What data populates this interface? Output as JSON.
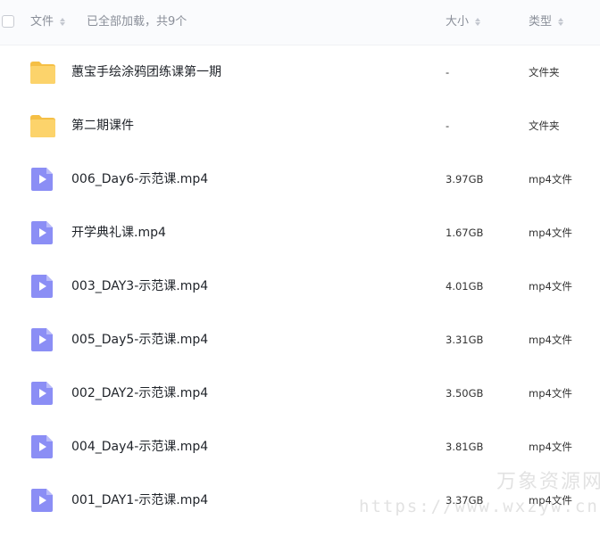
{
  "header": {
    "file_label": "文件",
    "status_text": "已全部加载，共9个",
    "size_label": "大小",
    "type_label": "类型"
  },
  "files": [
    {
      "name": "蕙宝手绘涂鸦团练课第一期",
      "size": "-",
      "type": "文件夹",
      "icon": "folder-icon"
    },
    {
      "name": "第二期课件",
      "size": "-",
      "type": "文件夹",
      "icon": "folder-icon"
    },
    {
      "name": "006_Day6-示范课.mp4",
      "size": "3.97GB",
      "type": "mp4文件",
      "icon": "video-file-icon"
    },
    {
      "name": "开学典礼课.mp4",
      "size": "1.67GB",
      "type": "mp4文件",
      "icon": "video-file-icon"
    },
    {
      "name": "003_DAY3-示范课.mp4",
      "size": "4.01GB",
      "type": "mp4文件",
      "icon": "video-file-icon"
    },
    {
      "name": "005_Day5-示范课.mp4",
      "size": "3.31GB",
      "type": "mp4文件",
      "icon": "video-file-icon"
    },
    {
      "name": "002_DAY2-示范课.mp4",
      "size": "3.50GB",
      "type": "mp4文件",
      "icon": "video-file-icon"
    },
    {
      "name": "004_Day4-示范课.mp4",
      "size": "3.81GB",
      "type": "mp4文件",
      "icon": "video-file-icon"
    },
    {
      "name": "001_DAY1-示范课.mp4",
      "size": "3.37GB",
      "type": "mp4文件",
      "icon": "video-file-icon"
    }
  ],
  "watermark": {
    "title": "万象资源网",
    "url": "https://www.wxzyw.cn"
  },
  "colors": {
    "folder": "#fcd36b",
    "video": "#8b8ef5",
    "header_bg": "#fafbfd"
  }
}
